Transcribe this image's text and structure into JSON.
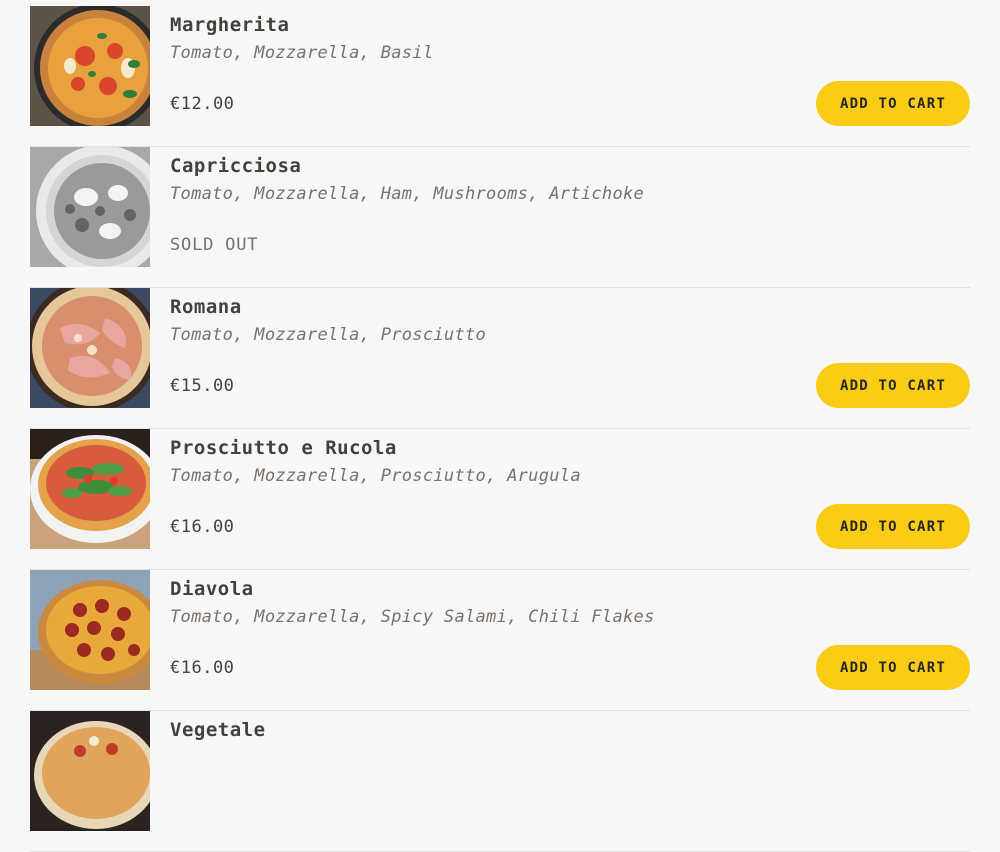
{
  "menu": {
    "items": [
      {
        "name": "Margherita",
        "ingredients": "Tomato, Mozzarella, Basil",
        "price": "€12.00",
        "sold_out": false,
        "button_label": "ADD TO CART"
      },
      {
        "name": "Capricciosa",
        "ingredients": "Tomato, Mozzarella, Ham, Mushrooms, Artichoke",
        "price": "SOLD OUT",
        "sold_out": true
      },
      {
        "name": "Romana",
        "ingredients": "Tomato, Mozzarella, Prosciutto",
        "price": "€15.00",
        "sold_out": false,
        "button_label": "ADD TO CART"
      },
      {
        "name": "Prosciutto e Rucola",
        "ingredients": "Tomato, Mozzarella, Prosciutto, Arugula",
        "price": "€16.00",
        "sold_out": false,
        "button_label": "ADD TO CART"
      },
      {
        "name": "Diavola",
        "ingredients": "Tomato, Mozzarella, Spicy Salami, Chili Flakes",
        "price": "€16.00",
        "sold_out": false,
        "button_label": "ADD TO CART"
      },
      {
        "name": "Vegetale"
      }
    ]
  },
  "colors": {
    "background": "#f7f7f7",
    "button": "#facc15",
    "text": "#44403c",
    "muted_text": "#78716c",
    "divider": "#e2e2e2"
  }
}
